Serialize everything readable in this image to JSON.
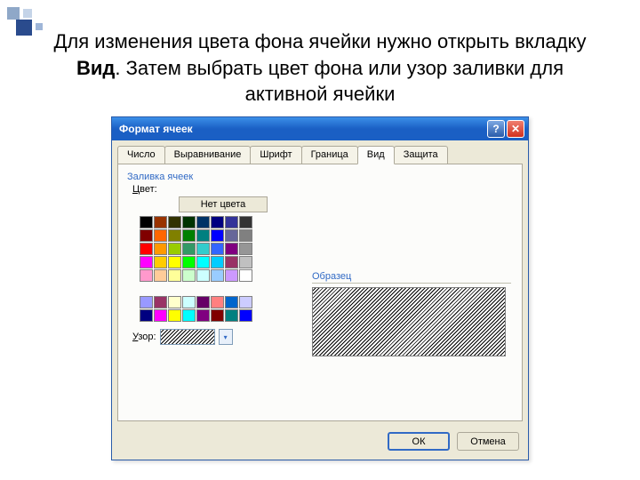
{
  "slide": {
    "text_before": "Для изменения цвета фона ячейки нужно открыть вкладку ",
    "text_bold": "Вид",
    "text_after": ". Затем выбрать цвет фона или узор заливки для активной ячейки"
  },
  "dialog": {
    "title": "Формат ячеек",
    "tabs": [
      "Число",
      "Выравнивание",
      "Шрифт",
      "Граница",
      "Вид",
      "Защита"
    ],
    "active_tab": "Вид",
    "group_fill": "Заливка ячеек",
    "color_label": "Цвет:",
    "no_color": "Нет цвета",
    "pattern_label": "Узор:",
    "sample_label": "Образец",
    "ok": "ОК",
    "cancel": "Отмена",
    "palette_main": [
      [
        "#000000",
        "#993300",
        "#333300",
        "#003300",
        "#003366",
        "#000080",
        "#333399",
        "#333333"
      ],
      [
        "#800000",
        "#ff6600",
        "#808000",
        "#008000",
        "#008080",
        "#0000ff",
        "#666699",
        "#808080"
      ],
      [
        "#ff0000",
        "#ff9900",
        "#99cc00",
        "#339966",
        "#33cccc",
        "#3366ff",
        "#800080",
        "#969696"
      ],
      [
        "#ff00ff",
        "#ffcc00",
        "#ffff00",
        "#00ff00",
        "#00ffff",
        "#00ccff",
        "#993366",
        "#c0c0c0"
      ],
      [
        "#ff99cc",
        "#ffcc99",
        "#ffff99",
        "#ccffcc",
        "#ccffff",
        "#99ccff",
        "#cc99ff",
        "#ffffff"
      ]
    ],
    "palette_extra": [
      [
        "#9999ff",
        "#993366",
        "#ffffcc",
        "#ccffff",
        "#660066",
        "#ff8080",
        "#0066cc",
        "#ccccff"
      ],
      [
        "#000080",
        "#ff00ff",
        "#ffff00",
        "#00ffff",
        "#800080",
        "#800000",
        "#008080",
        "#0000ff"
      ]
    ]
  }
}
